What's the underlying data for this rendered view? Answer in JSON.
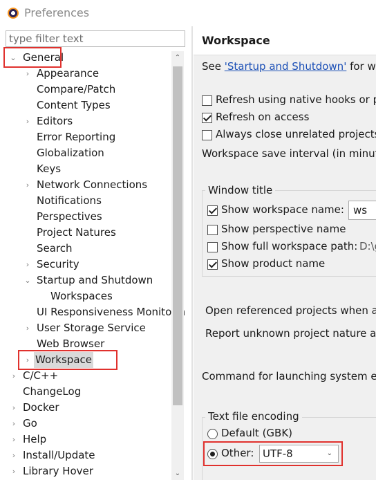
{
  "window": {
    "title": "Preferences"
  },
  "filter": {
    "placeholder": "type filter text"
  },
  "tree": {
    "general": "General",
    "general_children": [
      "Appearance",
      "Compare/Patch",
      "Content Types",
      "Editors",
      "Error Reporting",
      "Globalization",
      "Keys",
      "Network Connections",
      "Notifications",
      "Perspectives",
      "Project Natures",
      "Search",
      "Security",
      "Startup and Shutdown",
      "Workspaces",
      "UI Responsiveness Monitoring",
      "User Storage Service",
      "Web Browser",
      "Workspace"
    ],
    "top_level": [
      "C/C++",
      "ChangeLog",
      "Docker",
      "Go",
      "Help",
      "Install/Update",
      "Library Hover"
    ]
  },
  "page": {
    "title": "Workspace",
    "see_prefix": "See ",
    "see_link": "'Startup and Shutdown'",
    "see_suffix": " for workspace startup and shutdown preferences.",
    "opt_refresh_native": "Refresh using native hooks or polling",
    "opt_refresh_access": "Refresh on access",
    "opt_always_close": "Always close unrelated projects without prompt",
    "save_interval": "Workspace save interval (in minutes):",
    "window_title_group": "Window title",
    "show_ws_name": "Show workspace name:",
    "ws_name_value": "ws",
    "show_perspective": "Show perspective name",
    "show_full_path": "Show full workspace path:",
    "full_path_value": "D:\\go",
    "show_product": "Show product name",
    "open_referenced": "Open referenced projects when a project is opened:",
    "report_unknown": "Report unknown project nature as:",
    "cmd_launch": "Command for launching system explorer:",
    "encoding_group": "Text file encoding",
    "default_enc": "Default (GBK)",
    "other_enc": "Other:",
    "other_enc_value": "UTF-8"
  },
  "colors": {
    "highlight": "#e0312d",
    "link": "#1b4fb6"
  }
}
